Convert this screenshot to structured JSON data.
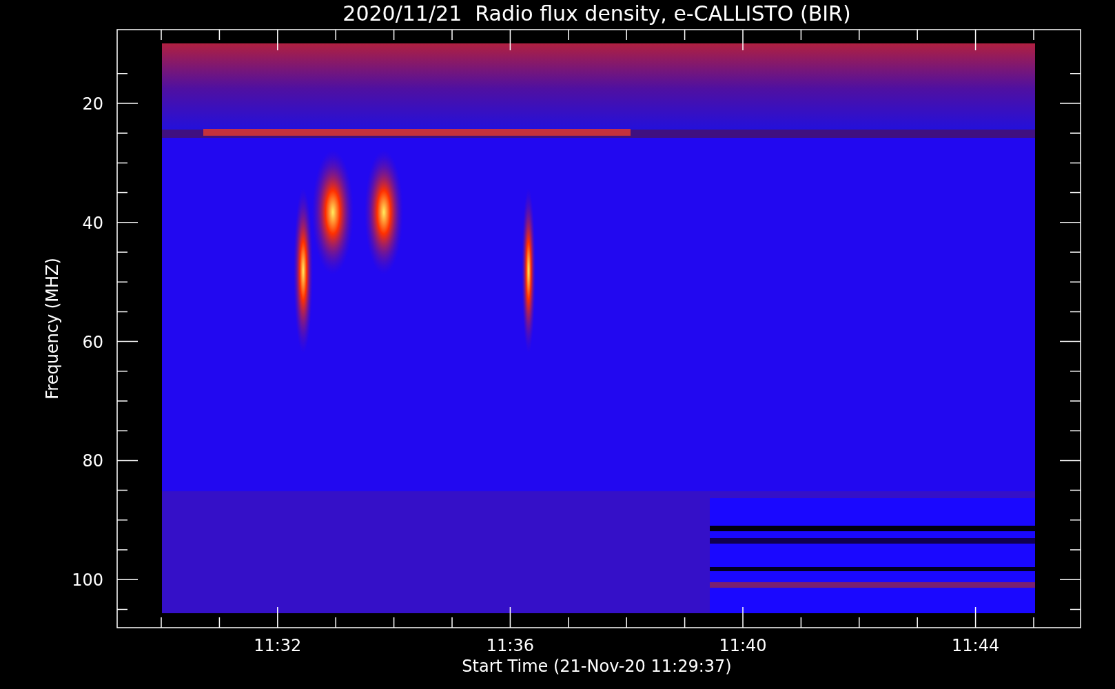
{
  "plot": {
    "title": "2020/11/21  Radio flux density, e-CALLISTO (BIR)",
    "y_label": "Frequency (MHZ)",
    "x_label": "Start Time (21-Nov-20 11:29:37)",
    "y_ticks": [
      "20",
      "40",
      "60",
      "80",
      "100"
    ],
    "x_ticks": [
      "11:32",
      "11:36",
      "11:40",
      "11:44"
    ]
  }
}
